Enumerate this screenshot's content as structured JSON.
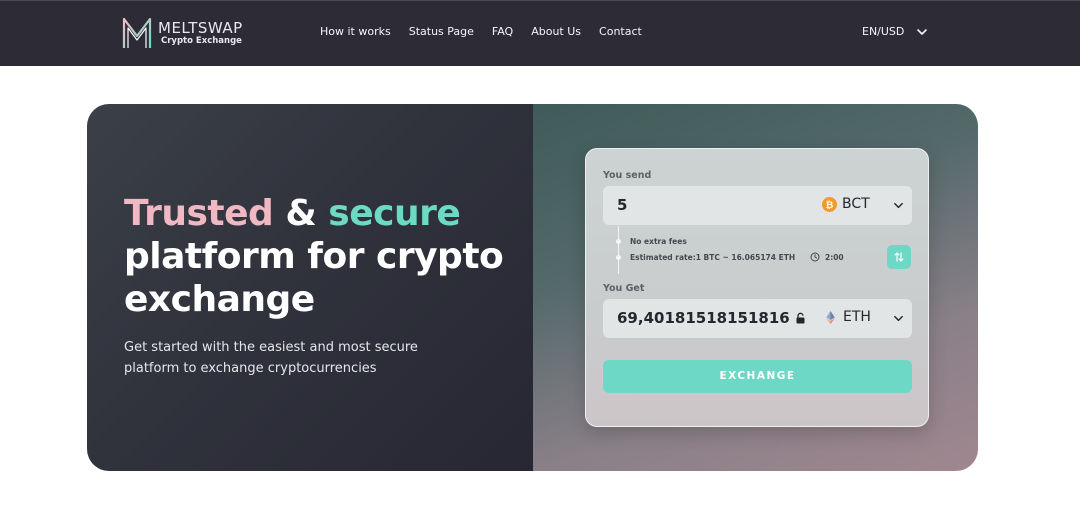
{
  "brand": {
    "name": "MELTSWAP",
    "subtitle": "Crypto Exchange"
  },
  "nav": {
    "links": [
      {
        "label": "How it works"
      },
      {
        "label": "Status Page"
      },
      {
        "label": "FAQ"
      },
      {
        "label": "About Us"
      },
      {
        "label": "Contact"
      }
    ],
    "locale": "EN/USD"
  },
  "hero": {
    "headline_word1": "Trusted",
    "headline_amp": " & ",
    "headline_word2": "secure",
    "headline_rest": " platform for crypto exchange",
    "subtext": "Get started with the easiest and most secure platform to exchange cryptocurrencies"
  },
  "exchange": {
    "send_label": "You send",
    "send_value": "5",
    "send_coin": "BCT",
    "send_coin_icon": "bitcoin-icon",
    "fees_text": "No extra fees",
    "rate_text": "Estimated rate:1 BTC ~ 16.065174 ETH",
    "timer": "2:00",
    "get_label": "You Get",
    "get_value": "69,40181518151816",
    "get_coin": "ETH",
    "get_coin_icon": "ethereum-icon",
    "button_label": "EXCHANGE"
  },
  "colors": {
    "nav_bg": "#2d2c36",
    "accent_teal": "#6ddbc4",
    "accent_pink": "#f0b8c2",
    "bitcoin_orange": "#f39a2a"
  }
}
